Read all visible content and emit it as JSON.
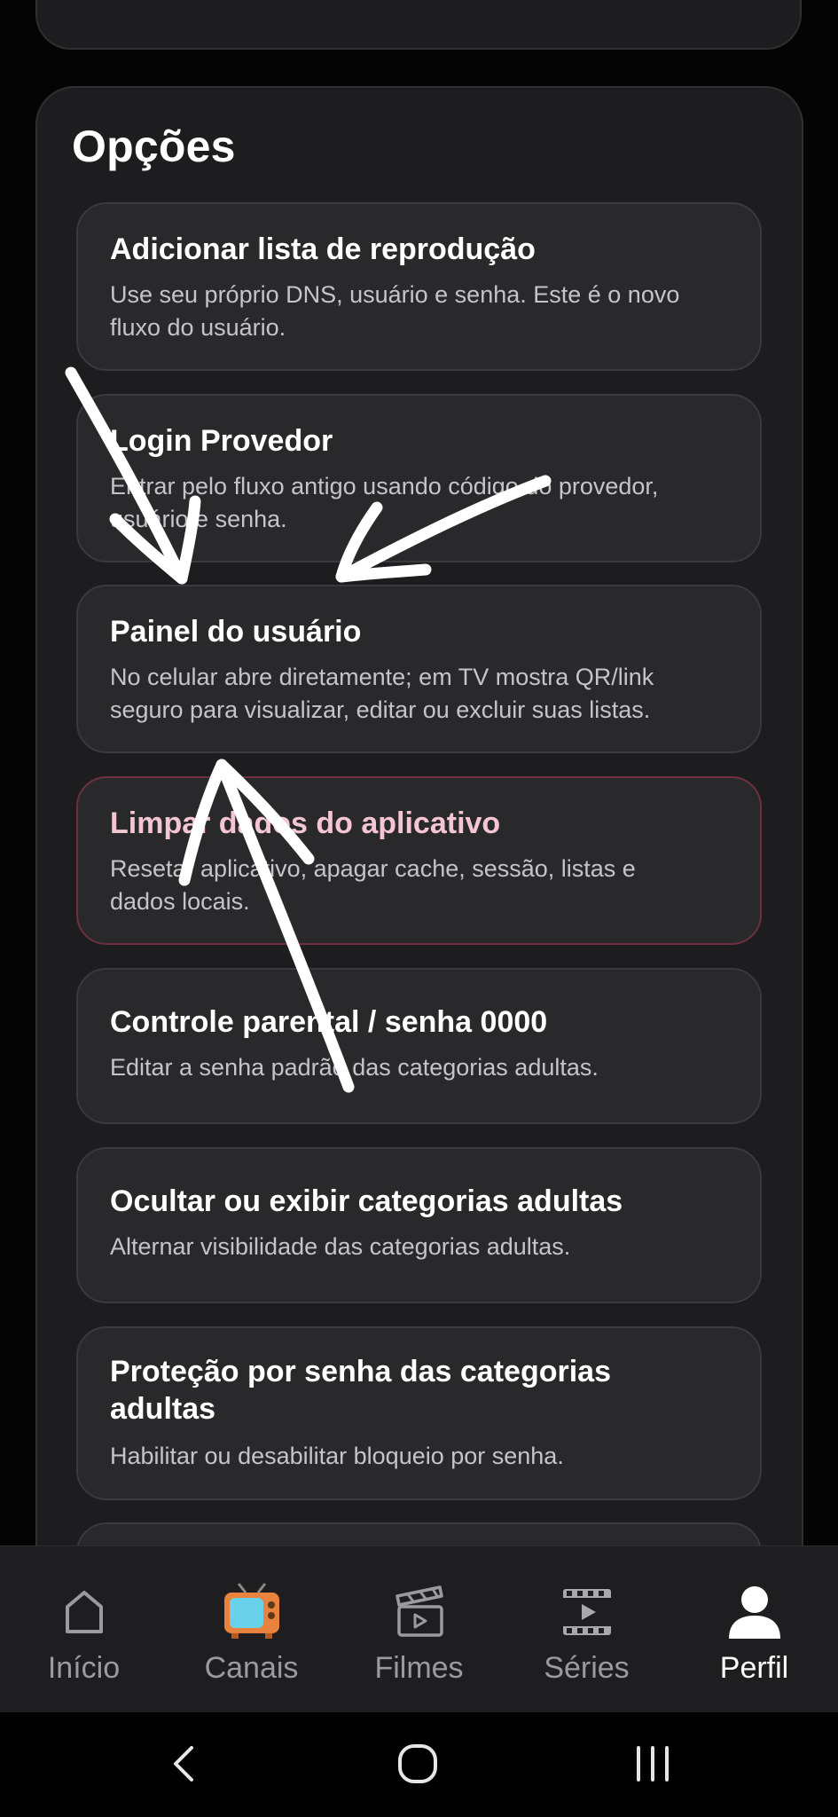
{
  "options": {
    "title": "Opções",
    "items": [
      {
        "title": "Adicionar lista de reprodução",
        "desc_line1": "Use seu próprio DNS, usuário e senha. Este é o novo",
        "desc_line2": "fluxo do usuário."
      },
      {
        "title": "Login Provedor",
        "desc_line1": "Entrar pelo fluxo antigo usando código do provedor,",
        "desc_line2": "usuário e senha."
      },
      {
        "title": "Painel do usuário",
        "desc_line1": "No celular abre diretamente; em TV mostra QR/link",
        "desc_line2": "seguro para visualizar, editar ou excluir suas listas."
      },
      {
        "title": "Limpar dados do aplicativo",
        "desc_line1": "Resetar aplicativo, apagar cache, sessão, listas e",
        "desc_line2": "dados locais."
      },
      {
        "title": "Controle parental / senha 0000",
        "desc_line1": "Editar a senha padrão das categorias adultas.",
        "desc_line2": ""
      },
      {
        "title": "Ocultar ou exibir categorias adultas",
        "desc_line1": "Alternar visibilidade das categorias adultas.",
        "desc_line2": ""
      },
      {
        "title_line1": "Proteção por senha das categorias",
        "title_line2": "adultas",
        "desc_line1": "Habilitar ou desabilitar bloqueio por senha.",
        "desc_line2": ""
      }
    ]
  },
  "nav": {
    "items": [
      {
        "label": "Início",
        "icon": "home-icon"
      },
      {
        "label": "Canais",
        "icon": "tv-icon"
      },
      {
        "label": "Filmes",
        "icon": "clapperboard-icon"
      },
      {
        "label": "Séries",
        "icon": "film-play-icon"
      },
      {
        "label": "Perfil",
        "icon": "person-icon"
      }
    ],
    "active": "Perfil"
  },
  "colors": {
    "background": "#040404",
    "card": "#1d1d1f",
    "option": "#29292c",
    "danger_title": "#f5c6d2",
    "nav_bg": "#1e1e21"
  }
}
